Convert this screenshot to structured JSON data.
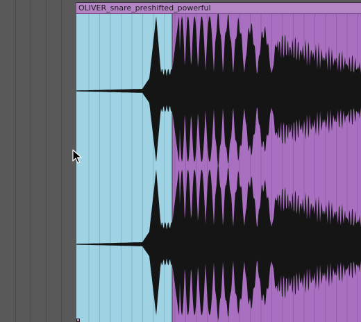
{
  "clip": {
    "name": "OLIVER_snare_preshifted_powerful",
    "colors": {
      "selected_region": "#9fd3e3",
      "unselected_region": "#a96fc0",
      "header": "#b486c6",
      "waveform": "#151515",
      "gridline": "#7eb7c9",
      "gridline_purple": "#9360a8"
    },
    "channels": [
      "left",
      "right"
    ],
    "selection": "start-to-transient"
  },
  "track_lane": {
    "background": "#595959"
  },
  "cursor": {
    "icon": "mouse-pointer-icon"
  }
}
